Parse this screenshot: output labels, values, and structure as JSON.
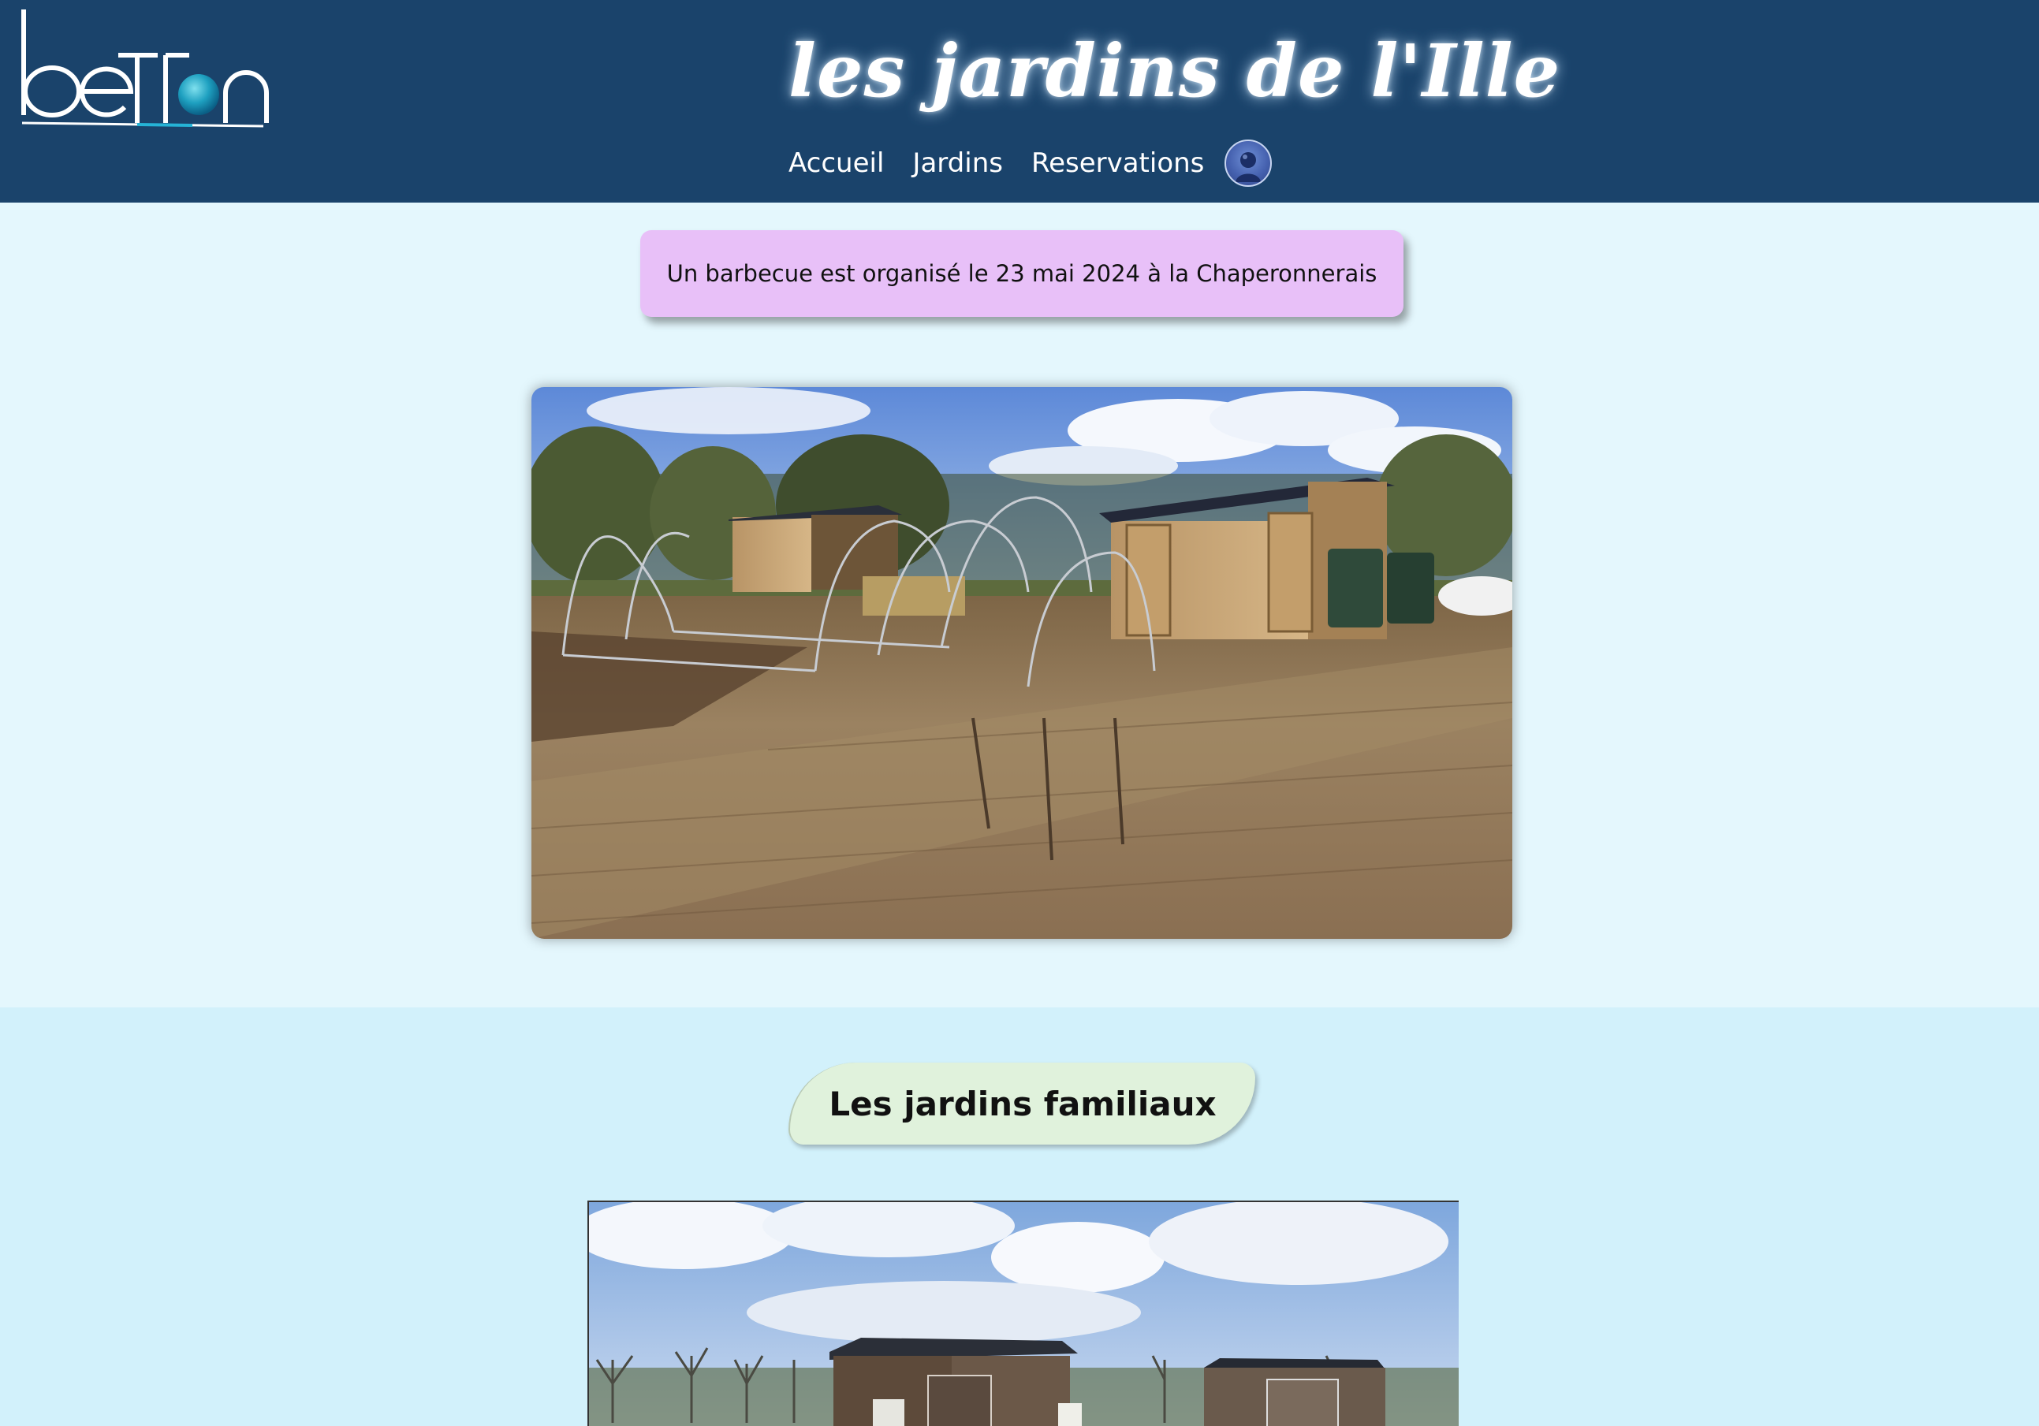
{
  "header": {
    "logo_text": "betton",
    "site_title": "les jardins de l'Ille",
    "nav": [
      {
        "label": "Accueil"
      },
      {
        "label": "Jardins"
      },
      {
        "label": "Reservations"
      }
    ]
  },
  "announcement": {
    "text": "Un barbecue est organisé le 23 mai 2024 à la Chaperonnerais"
  },
  "section": {
    "title": "Les jardins familiaux"
  },
  "colors": {
    "header_bg": "#1a436b",
    "page_bg": "#e4f7fd",
    "section_bg": "#d2f1fb",
    "announcement_bg": "#e8c0f8",
    "section_title_bg": "#e0f2dc"
  },
  "icons": {
    "account": "user-avatar-icon"
  }
}
